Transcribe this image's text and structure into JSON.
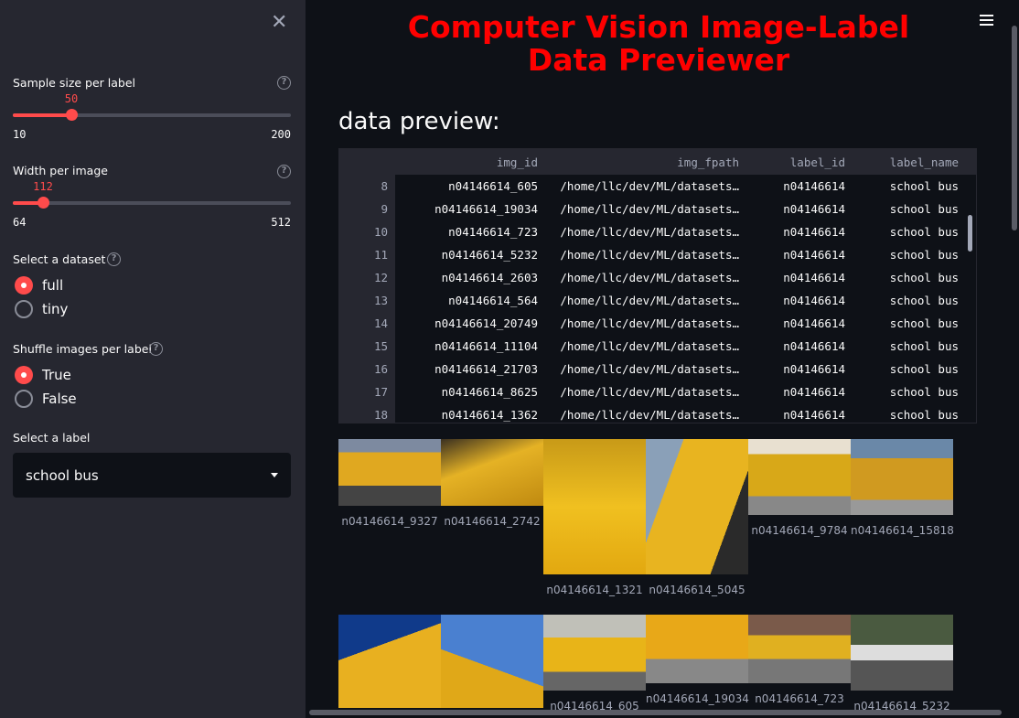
{
  "sidebar": {
    "sample_size": {
      "label": "Sample size per label",
      "value": "50",
      "min": "10",
      "max": "200",
      "fraction": 0.2105
    },
    "width": {
      "label": "Width per image",
      "value": "112",
      "min": "64",
      "max": "512",
      "fraction": 0.107
    },
    "dataset": {
      "label": "Select a dataset",
      "options": [
        "full",
        "tiny"
      ],
      "selected": "full"
    },
    "shuffle": {
      "label": "Shuffle images per label",
      "options": [
        "True",
        "False"
      ],
      "selected": "True"
    },
    "label_select": {
      "label": "Select a label",
      "value": "school bus"
    }
  },
  "main": {
    "title": "Computer Vision Image-Label Data Previewer",
    "subtitle": "data preview:",
    "table": {
      "columns": [
        "img_id",
        "img_fpath",
        "label_id",
        "label_name"
      ],
      "rows": [
        [
          "8",
          "n04146614_605",
          "/home/llc/dev/ML/datasets…",
          "n04146614",
          "school bus"
        ],
        [
          "9",
          "n04146614_19034",
          "/home/llc/dev/ML/datasets…",
          "n04146614",
          "school bus"
        ],
        [
          "10",
          "n04146614_723",
          "/home/llc/dev/ML/datasets…",
          "n04146614",
          "school bus"
        ],
        [
          "11",
          "n04146614_5232",
          "/home/llc/dev/ML/datasets…",
          "n04146614",
          "school bus"
        ],
        [
          "12",
          "n04146614_2603",
          "/home/llc/dev/ML/datasets…",
          "n04146614",
          "school bus"
        ],
        [
          "13",
          "n04146614_564",
          "/home/llc/dev/ML/datasets…",
          "n04146614",
          "school bus"
        ],
        [
          "14",
          "n04146614_20749",
          "/home/llc/dev/ML/datasets…",
          "n04146614",
          "school bus"
        ],
        [
          "15",
          "n04146614_11104",
          "/home/llc/dev/ML/datasets…",
          "n04146614",
          "school bus"
        ],
        [
          "16",
          "n04146614_21703",
          "/home/llc/dev/ML/datasets…",
          "n04146614",
          "school bus"
        ],
        [
          "17",
          "n04146614_8625",
          "/home/llc/dev/ML/datasets…",
          "n04146614",
          "school bus"
        ],
        [
          "18",
          "n04146614_1362",
          "/home/llc/dev/ML/datasets…",
          "n04146614",
          "school bus"
        ]
      ]
    },
    "images_row1": [
      "n04146614_9327",
      "n04146614_2742",
      "n04146614_1321",
      "n04146614_5045",
      "n04146614_9784",
      "n04146614_15818"
    ],
    "images_row2": [
      "",
      "",
      "n04146614_605",
      "n04146614_19034",
      "n04146614_723",
      "n04146614_5232"
    ]
  },
  "colors": {
    "accent": "#ff4b4b",
    "title": "#ff0000",
    "bus_yellow": "#e8b020"
  }
}
